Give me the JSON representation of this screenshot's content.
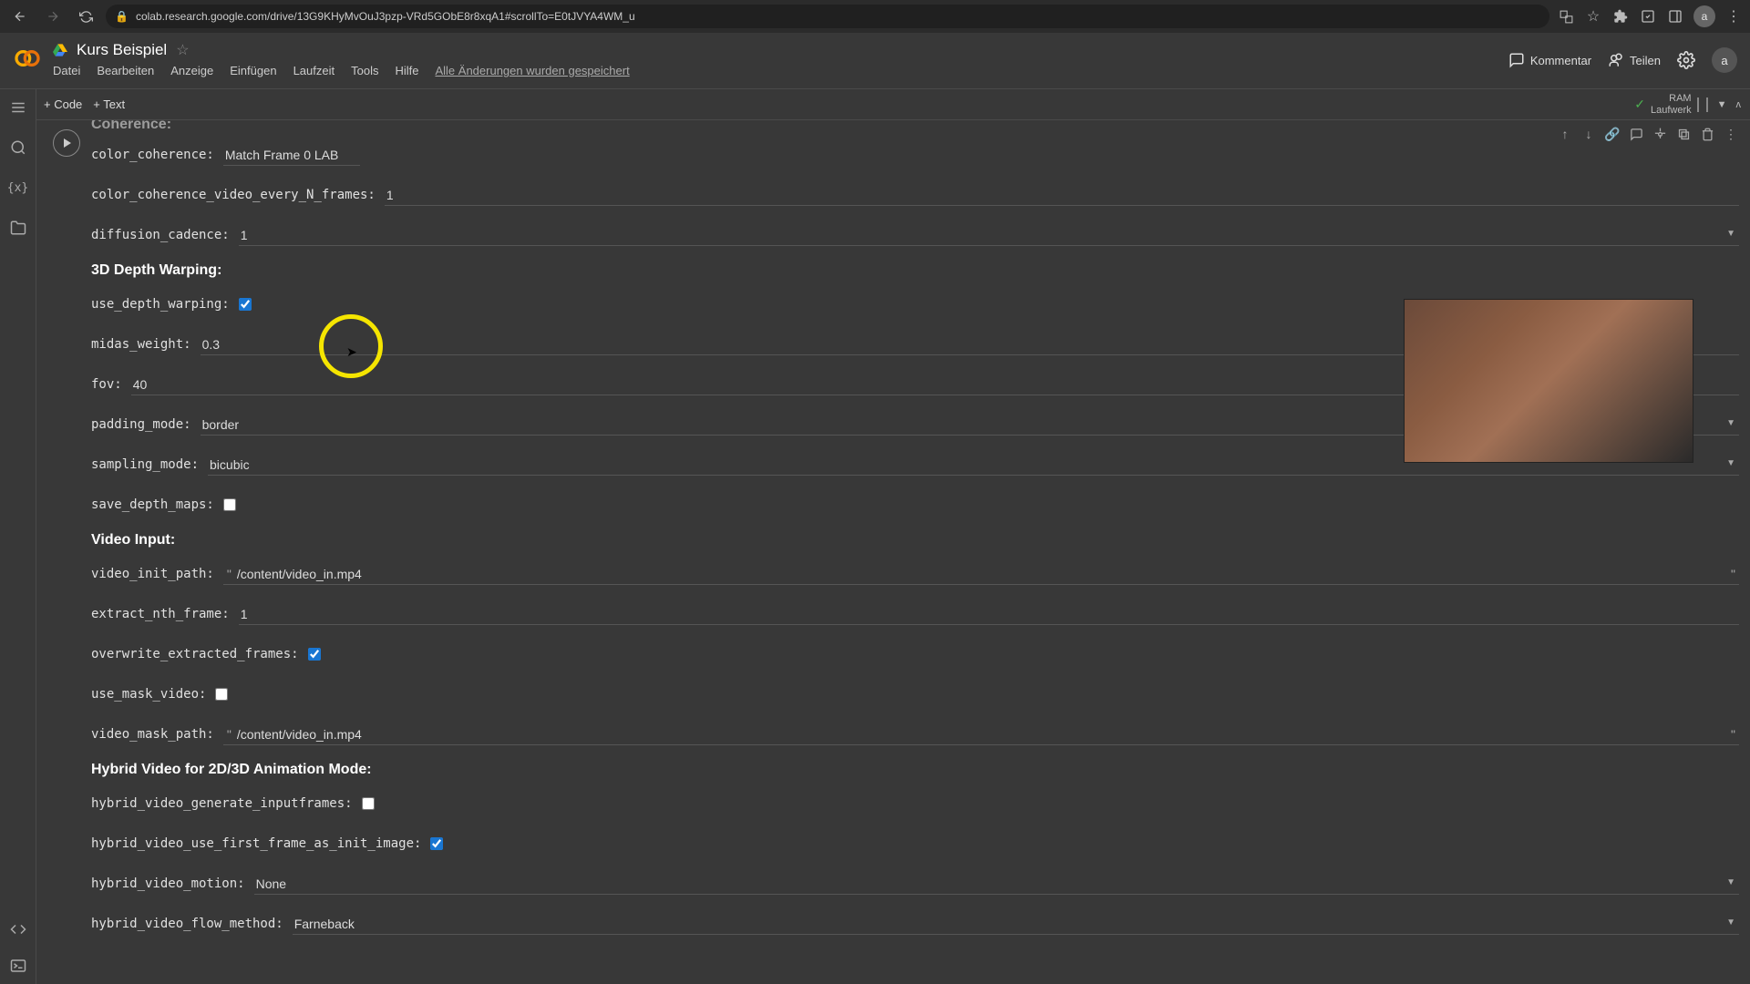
{
  "browser": {
    "url": "colab.research.google.com/drive/13G9KHyMvOuJ3pzp-VRd5GObE8r8xqA1#scrollTo=E0tJVYA4WM_u"
  },
  "header": {
    "title": "Kurs Beispiel",
    "menu": [
      "Datei",
      "Bearbeiten",
      "Anzeige",
      "Einfügen",
      "Laufzeit",
      "Tools",
      "Hilfe"
    ],
    "saved_status": "Alle Änderungen wurden gespeichert",
    "comment": "Kommentar",
    "share": "Teilen",
    "avatar": "a"
  },
  "toolbar": {
    "code": "+ Code",
    "text": "+ Text",
    "ram": "RAM",
    "runtime": "Laufwerk"
  },
  "sections": {
    "coherence": "Coherence:",
    "depth": "3D Depth Warping:",
    "video": "Video Input:",
    "hybrid": "Hybrid Video for 2D/3D Animation Mode:"
  },
  "params": {
    "color_coherence": {
      "label": "color_coherence:",
      "value": "Match Frame 0 LAB"
    },
    "color_coherence_video_every_N_frames": {
      "label": "color_coherence_video_every_N_frames:",
      "value": "1"
    },
    "diffusion_cadence": {
      "label": "diffusion_cadence:",
      "value": "1"
    },
    "use_depth_warping": {
      "label": "use_depth_warping:"
    },
    "midas_weight": {
      "label": "midas_weight:",
      "value": "0.3"
    },
    "fov": {
      "label": "fov:",
      "value": "40"
    },
    "padding_mode": {
      "label": "padding_mode:",
      "value": "border"
    },
    "sampling_mode": {
      "label": "sampling_mode:",
      "value": "bicubic"
    },
    "save_depth_maps": {
      "label": "save_depth_maps:"
    },
    "video_init_path": {
      "label": "video_init_path:",
      "value": "/content/video_in.mp4"
    },
    "extract_nth_frame": {
      "label": "extract_nth_frame:",
      "value": "1"
    },
    "overwrite_extracted_frames": {
      "label": "overwrite_extracted_frames:"
    },
    "use_mask_video": {
      "label": "use_mask_video:"
    },
    "video_mask_path": {
      "label": "video_mask_path:",
      "value": "/content/video_in.mp4"
    },
    "hybrid_video_generate_inputframes": {
      "label": "hybrid_video_generate_inputframes:"
    },
    "hybrid_video_use_first_frame_as_init_image": {
      "label": "hybrid_video_use_first_frame_as_init_image:"
    },
    "hybrid_video_motion": {
      "label": "hybrid_video_motion:",
      "value": "None"
    },
    "hybrid_video_flow_method": {
      "label": "hybrid_video_flow_method:",
      "value": "Farneback"
    }
  }
}
